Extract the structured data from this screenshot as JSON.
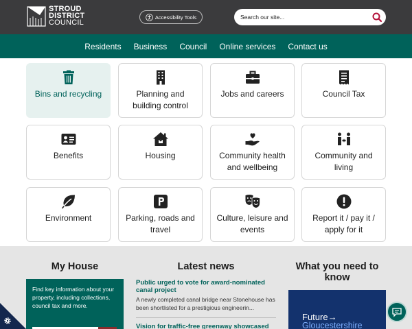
{
  "header": {
    "logo": {
      "line1": "STROUD",
      "line2": "DISTRICT",
      "line3": "COUNCIL"
    },
    "accessibility_label": "Accessibility Tools",
    "search_placeholder": "Search our site..."
  },
  "nav": [
    {
      "label": "Residents"
    },
    {
      "label": "Business"
    },
    {
      "label": "Council"
    },
    {
      "label": "Online services"
    },
    {
      "label": "Contact us"
    }
  ],
  "tiles": [
    {
      "label": "Bins and recycling",
      "icon": "trash-bin-icon",
      "active": true
    },
    {
      "label": "Planning and building control",
      "icon": "building-icon"
    },
    {
      "label": "Jobs and careers",
      "icon": "briefcase-icon"
    },
    {
      "label": "Council Tax",
      "icon": "receipt-icon"
    },
    {
      "label": "Benefits",
      "icon": "id-card-icon"
    },
    {
      "label": "Housing",
      "icon": "house-icon"
    },
    {
      "label": "Community health and wellbeing",
      "icon": "hand-heart-icon"
    },
    {
      "label": "Community and living",
      "icon": "people-arrows-icon"
    },
    {
      "label": "Environment",
      "icon": "leaf-icon"
    },
    {
      "label": "Parking, roads and travel",
      "icon": "parking-icon"
    },
    {
      "label": "Culture, leisure and events",
      "icon": "theater-masks-icon"
    },
    {
      "label": "Report it / pay it / apply for it",
      "icon": "exclamation-icon"
    }
  ],
  "my_house": {
    "title": "My House",
    "text": "Find key information about your property, including collections, council tax and more."
  },
  "latest_news": {
    "title": "Latest news",
    "items": [
      {
        "title": "Public urged to vote for award-nominated canal project",
        "snippet": "A newly completed canal bridge near Stonehouse has been shortlisted for a prestigious engineerin..."
      },
      {
        "title": "Vision for traffic-free greenway showcased",
        "snippet": ""
      }
    ]
  },
  "need_to_know": {
    "title": "What you need to know",
    "banner_line1": "Future→",
    "banner_line2": "Gloucestershire"
  },
  "colors": {
    "header_bg": "#3b3b3d",
    "brand_teal": "#00625a",
    "active_tile_bg": "#e6f1ef",
    "search_icon": "#b3123a",
    "banner_navy": "#13326d"
  }
}
